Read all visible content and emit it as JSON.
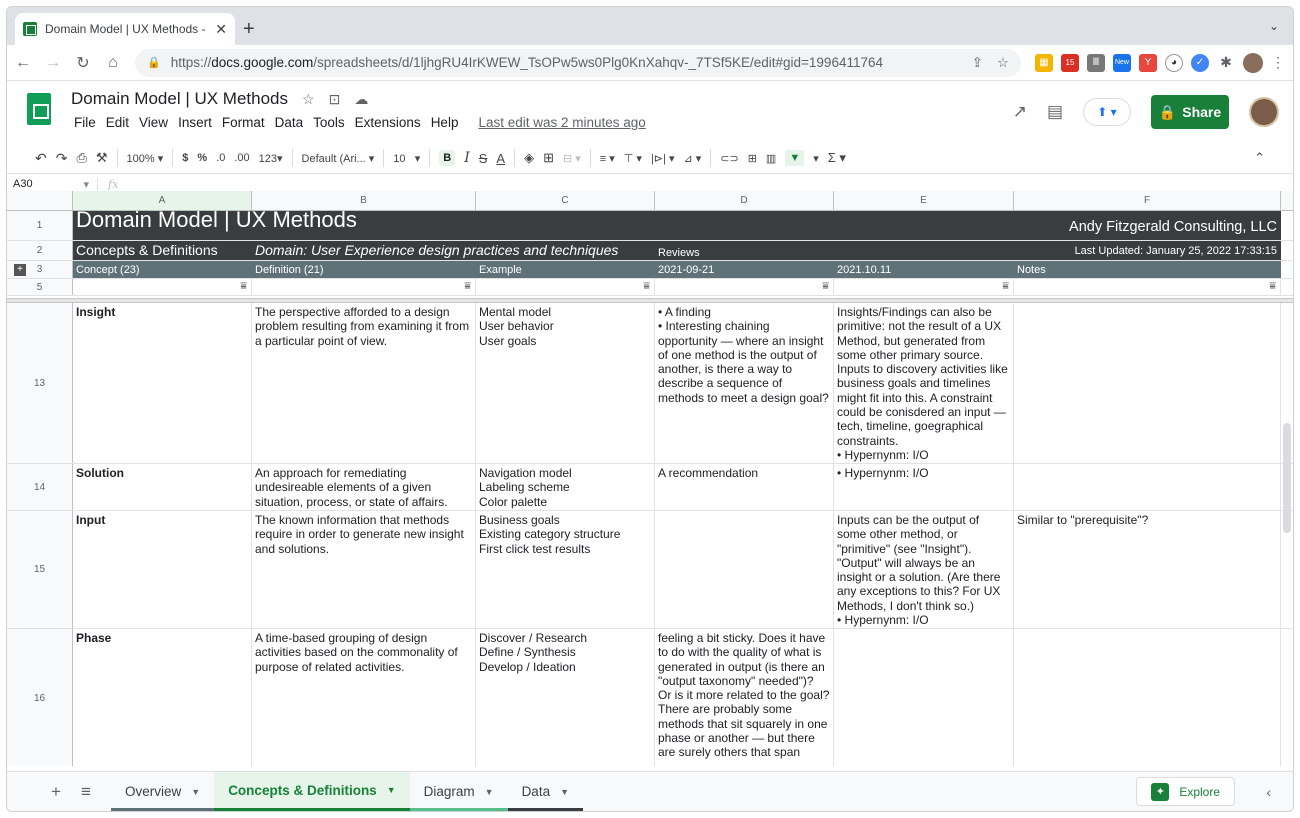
{
  "browser": {
    "tab_title": "Domain Model | UX Methods -",
    "url_prefix": "https://",
    "url_host": "docs.google.com",
    "url_path": "/spreadsheets/d/1ljhgRU4IrKWEW_TsOPw5ws0Plg0KnXahqv-_7TSf5KE/edit#gid=1996411764",
    "ext_badge": "15",
    "ext_new": "New"
  },
  "doc": {
    "title": "Domain Model | UX Methods",
    "menus": [
      "File",
      "Edit",
      "View",
      "Insert",
      "Format",
      "Data",
      "Tools",
      "Extensions",
      "Help"
    ],
    "last_edit": "Last edit was 2 minutes ago",
    "share_label": "Share"
  },
  "toolbar": {
    "zoom": "100%",
    "currency": "$",
    "percent": "%",
    "dec_less": ".0",
    "dec_more": ".00",
    "format": "123",
    "font": "Default (Ari...",
    "size": "10",
    "bold": "B",
    "italic": "I",
    "strike": "S",
    "textcolor": "A"
  },
  "formula": {
    "cell": "A30",
    "fx": "fx"
  },
  "columns": [
    "A",
    "B",
    "C",
    "D",
    "E",
    "F"
  ],
  "header_rows": {
    "r1": {
      "num": "1",
      "a": "Domain Model | UX Methods",
      "f": "Andy Fitzgerald Consulting, LLC"
    },
    "r2": {
      "num": "2",
      "a": "Concepts & Definitions",
      "b": "Domain: User Experience design practices and techniques",
      "d": "Reviews",
      "f": "Last Updated: January 25, 2022 17:33:15"
    },
    "r3": {
      "num": "3",
      "a": "Concept (23)",
      "b": "Definition (21)",
      "c": "Example",
      "d": "2021-09-21",
      "e": "2021.10.11",
      "f": "Notes"
    },
    "r5": {
      "num": "5"
    }
  },
  "rows": [
    {
      "num": "13",
      "a": "Insight",
      "b": "The perspective afforded to a design problem resulting from examining it from a particular point of view.",
      "c": "Mental model\nUser behavior\nUser goals",
      "d": "• A finding\n• Interesting chaining opportunity — where an insight of one method is the output of another, is there a way to describe a sequence of methods to meet a design goal?",
      "e": "Insights/Findings can also be primitive: not the result of a UX Method, but generated from some other primary source. Inputs to discovery activities like business goals and timelines might fit into this. A constraint could be conisdered an input — tech, timeline, goegraphical constraints.\n• Hypernynm: I/O",
      "f": ""
    },
    {
      "num": "14",
      "a": "Solution",
      "b": "An approach for remediating undesireable elements of a given situation, process, or state of affairs.",
      "c": "Navigation model\nLabeling scheme\nColor palette",
      "d": "A recommendation",
      "e": "• Hypernynm: I/O",
      "f": ""
    },
    {
      "num": "15",
      "a": "Input",
      "b": "The known information that methods require in order to generate new insight and solutions.",
      "c": "Business goals\nExisting category structure\nFirst click test results",
      "d": "",
      "e": "Inputs can be the output of some other method, or \"primitive\" (see \"Insight\"). \"Output\" will always be an insight or a solution. (Are there any exceptions to this? For UX Methods, I don't think so.)\n• Hypernynm: I/O",
      "f": "Similar to \"prerequisite\"?"
    },
    {
      "num": "16",
      "a": "Phase",
      "b": "A time-based grouping of design activities based on the commonality of purpose of related activities.",
      "c": "Discover / Research\nDefine / Synthesis\nDevelop / Ideation",
      "d": "feeling a bit sticky. Does it have to do with the quality of what is generated in output (is there an \"output taxonomy\" needed\")? Or is it more related to the goal? There are probably some methods that sit squarely in one phase or another — but there are surely others that span",
      "e": "",
      "f": ""
    }
  ],
  "sheets": [
    {
      "label": "Overview",
      "color": "#5f7278"
    },
    {
      "label": "Concepts & Definitions",
      "color": "#188038"
    },
    {
      "label": "Diagram",
      "color": "#57bb8a"
    },
    {
      "label": "Data",
      "color": "#3a3d40"
    }
  ],
  "explore_label": "Explore"
}
